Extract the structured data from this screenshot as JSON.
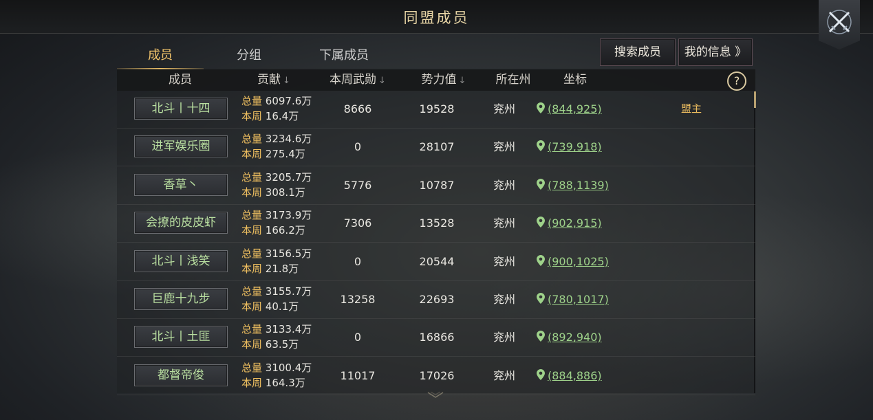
{
  "title": "同盟成员",
  "tabs": [
    {
      "label": "成员",
      "active": true
    },
    {
      "label": "分组",
      "active": false
    },
    {
      "label": "下属成员",
      "active": false
    }
  ],
  "buttons": {
    "search": "搜索成员",
    "my_info": "我的信息 》"
  },
  "columns": {
    "member": "成员",
    "contribution": "贡献",
    "weekly_merit": "本周武勋",
    "power": "势力值",
    "state": "所在州",
    "coords": "坐标",
    "sort_arrow": "↓"
  },
  "help_label": "?",
  "contrib_labels": {
    "total": "总量",
    "week": "本周"
  },
  "colors": {
    "accent": "#f2c46b",
    "name_text": "#b9dfa0",
    "coord_text": "#9ed28a",
    "label_gold": "#f0c060"
  },
  "members": [
    {
      "name": "北斗丨十四",
      "total": "6097.6万",
      "week": "16.4万",
      "merit": "8666",
      "power": "19528",
      "state": "兖州",
      "coords": "(844,925)",
      "role": "盟主"
    },
    {
      "name": "进军娱乐圈",
      "total": "3234.6万",
      "week": "275.4万",
      "merit": "0",
      "power": "28107",
      "state": "兖州",
      "coords": "(739,918)",
      "role": ""
    },
    {
      "name": "香草丶",
      "total": "3205.7万",
      "week": "308.1万",
      "merit": "5776",
      "power": "10787",
      "state": "兖州",
      "coords": "(788,1139)",
      "role": ""
    },
    {
      "name": "会撩的皮皮虾",
      "total": "3173.9万",
      "week": "166.2万",
      "merit": "7306",
      "power": "13528",
      "state": "兖州",
      "coords": "(902,915)",
      "role": ""
    },
    {
      "name": "北斗丨浅笑",
      "total": "3156.5万",
      "week": "21.8万",
      "merit": "0",
      "power": "20544",
      "state": "兖州",
      "coords": "(900,1025)",
      "role": ""
    },
    {
      "name": "巨鹿十九步",
      "total": "3155.7万",
      "week": "40.1万",
      "merit": "13258",
      "power": "22693",
      "state": "兖州",
      "coords": "(780,1017)",
      "role": ""
    },
    {
      "name": "北斗丨土匪",
      "total": "3133.4万",
      "week": "63.5万",
      "merit": "0",
      "power": "16866",
      "state": "兖州",
      "coords": "(892,940)",
      "role": ""
    },
    {
      "name": "都督帝俊",
      "total": "3100.4万",
      "week": "164.3万",
      "merit": "11017",
      "power": "17026",
      "state": "兖州",
      "coords": "(884,886)",
      "role": ""
    }
  ]
}
